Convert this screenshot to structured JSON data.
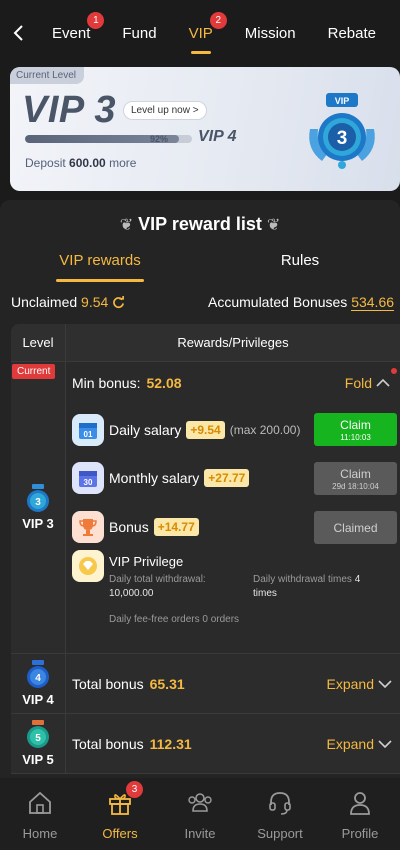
{
  "nav": {
    "tabs": [
      {
        "label": "Event",
        "badge": "1"
      },
      {
        "label": "Fund"
      },
      {
        "label": "VIP",
        "badge": "2"
      },
      {
        "label": "Mission"
      },
      {
        "label": "Rebate"
      }
    ]
  },
  "vip_card": {
    "current_level_tag": "Current Level",
    "title": "VIP 3",
    "level_up": "Level up now >",
    "progress_percent_label": "92%",
    "progress": 0.92,
    "next_level": "VIP 4",
    "deposit_prefix": "Deposit",
    "deposit_amount": "600.00",
    "deposit_suffix": "more",
    "medal_number": "3",
    "medal_label": "VIP"
  },
  "panel": {
    "title": "VIP reward list",
    "tabs": [
      "VIP rewards",
      "Rules"
    ],
    "unclaimed_label": "Unclaimed",
    "unclaimed_value": "9.54",
    "accumulated_label": "Accumulated Bonuses",
    "accumulated_value": "534.66"
  },
  "table": {
    "header_level": "Level",
    "header_rewards": "Rewards/Privileges",
    "current_tag": "Current",
    "vip3": {
      "level": "VIP 3",
      "badge_number": "3",
      "min_bonus_label": "Min bonus:",
      "min_bonus_value": "52.08",
      "fold_label": "Fold",
      "daily": {
        "label": "Daily salary",
        "chip": "+9.54",
        "max": "(max 200.00)",
        "icon_day": "01",
        "button": "Claim",
        "timer": "11:10:03"
      },
      "monthly": {
        "label": "Monthly salary",
        "chip": "+27.77",
        "icon_day": "30",
        "button": "Claim",
        "timer": "29d 18:10:04"
      },
      "bonus": {
        "label": "Bonus",
        "chip": "+14.77",
        "button": "Claimed"
      },
      "privilege": {
        "title": "VIP Privilege",
        "withdrawal_label": "Daily total withdrawal:",
        "withdrawal_value": "10,000.00",
        "times_label": "Daily withdrawal times",
        "times_value": "4",
        "times_unit": "times",
        "fee_free": "Daily fee-free orders 0 orders"
      }
    },
    "vip4": {
      "level": "VIP 4",
      "badge_number": "4",
      "label": "Total bonus",
      "value": "65.31",
      "expand": "Expand"
    },
    "vip5": {
      "level": "VIP 5",
      "badge_number": "5",
      "label": "Total bonus",
      "value": "112.31",
      "expand": "Expand"
    }
  },
  "bottom_nav": [
    {
      "label": "Home",
      "icon": "home-icon"
    },
    {
      "label": "Offers",
      "icon": "gift-icon",
      "badge": "3"
    },
    {
      "label": "Invite",
      "icon": "people-icon"
    },
    {
      "label": "Support",
      "icon": "headset-icon"
    },
    {
      "label": "Profile",
      "icon": "user-icon"
    }
  ],
  "colors": {
    "accent": "#f5b942",
    "badge": "#e03a3a",
    "claim_green": "#16b41f"
  }
}
